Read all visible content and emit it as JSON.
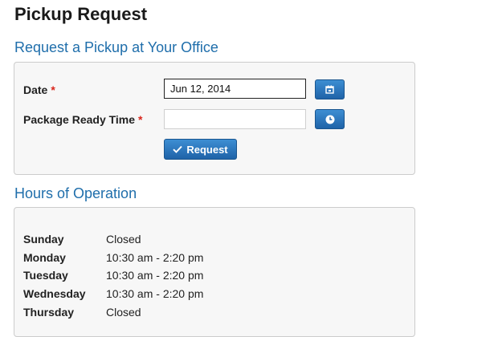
{
  "page": {
    "title": "Pickup Request"
  },
  "request_section": {
    "title": "Request a Pickup at Your Office",
    "date_label": "Date",
    "date_required": "*",
    "date_value": "Jun 12, 2014",
    "ready_time_label": "Package Ready Time",
    "ready_time_required": "*",
    "ready_time_value": "",
    "calendar_icon": "calendar-icon",
    "clock_icon": "clock-icon",
    "request_label": "Request",
    "request_icon": "check-icon"
  },
  "hours_section": {
    "title": "Hours of Operation",
    "rows": [
      {
        "day": "Sunday",
        "hours": "Closed"
      },
      {
        "day": "Monday",
        "hours": "10:30 am - 2:20 pm"
      },
      {
        "day": "Tuesday",
        "hours": "10:30 am - 2:20 pm"
      },
      {
        "day": "Wednesday",
        "hours": "10:30 am - 2:20 pm"
      },
      {
        "day": "Thursday",
        "hours": "Closed"
      }
    ]
  },
  "colors": {
    "accent": "#1f6eab",
    "button": "#2a74bd",
    "required": "#d9261c",
    "panel_bg": "#f7f7f7"
  }
}
